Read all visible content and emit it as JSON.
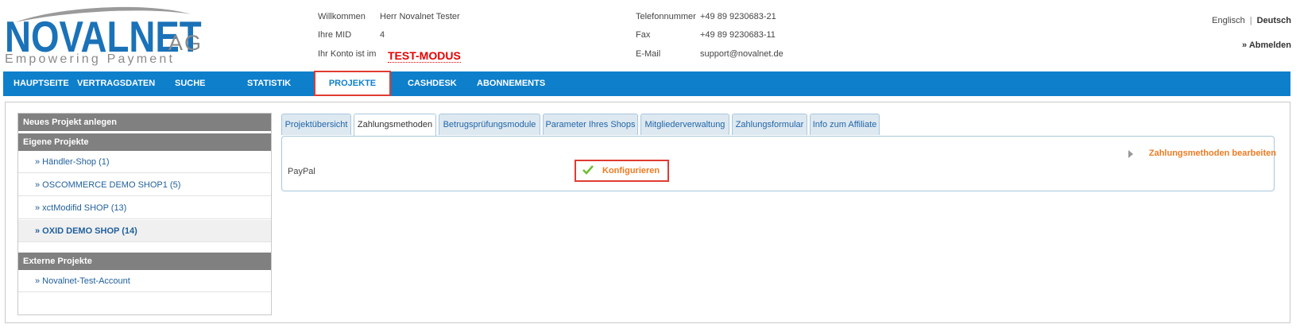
{
  "logo": {
    "name": "NOVALNET",
    "suffix": "AG",
    "tagline": "Empowering Payment"
  },
  "header": {
    "welcome_label": "Willkommen",
    "welcome_value": "Herr Novalnet Tester",
    "mid_label": "Ihre MID",
    "mid_value": "4",
    "account_label": "Ihr Konto ist im",
    "account_mode": "TEST-MODUS",
    "phone_label": "Telefonnummer",
    "phone_value": "+49 89 9230683-21",
    "fax_label": "Fax",
    "fax_value": "+49 89 9230683-11",
    "email_label": "E-Mail",
    "email_value": "support@novalnet.de"
  },
  "lang": {
    "english": "Englisch",
    "separator": "|",
    "german": "Deutsch"
  },
  "logout": "» Abmelden",
  "nav": {
    "home": "HAUPTSEITE",
    "contract": "VERTRAGSDATEN",
    "search": "SUCHE",
    "stats": "STATISTIK",
    "projects": "PROJEKTE",
    "cashdesk": "CASHDESK",
    "subscriptions": "ABONNEMENTS"
  },
  "sidebar": {
    "new_project": "Neues Projekt anlegen",
    "own_projects": "Eigene Projekte",
    "items": [
      "» Händler-Shop (1)",
      "» OSCOMMERCE DEMO SHOP1 (5)",
      "» xctModifid SHOP (13)",
      "» OXID DEMO SHOP (14)"
    ],
    "external_projects": "Externe Projekte",
    "external_items": [
      "» Novalnet-Test-Account"
    ]
  },
  "tabs": [
    "Projektübersicht",
    "Zahlungsmethoden",
    "Betrugsprüfungsmodule",
    "Parameter Ihres Shops",
    "Mitgliederverwaltung",
    "Zahlungsformular",
    "Info zum Affiliate"
  ],
  "panel": {
    "edit_link": "Zahlungsmethoden bearbeiten",
    "method_name": "PayPal",
    "configure": "Konfigurieren"
  },
  "colors": {
    "brand_blue": "#0d7fcb",
    "accent_orange": "#ee7b22",
    "highlight_red": "#e03c31",
    "test_red": "#e60000"
  }
}
